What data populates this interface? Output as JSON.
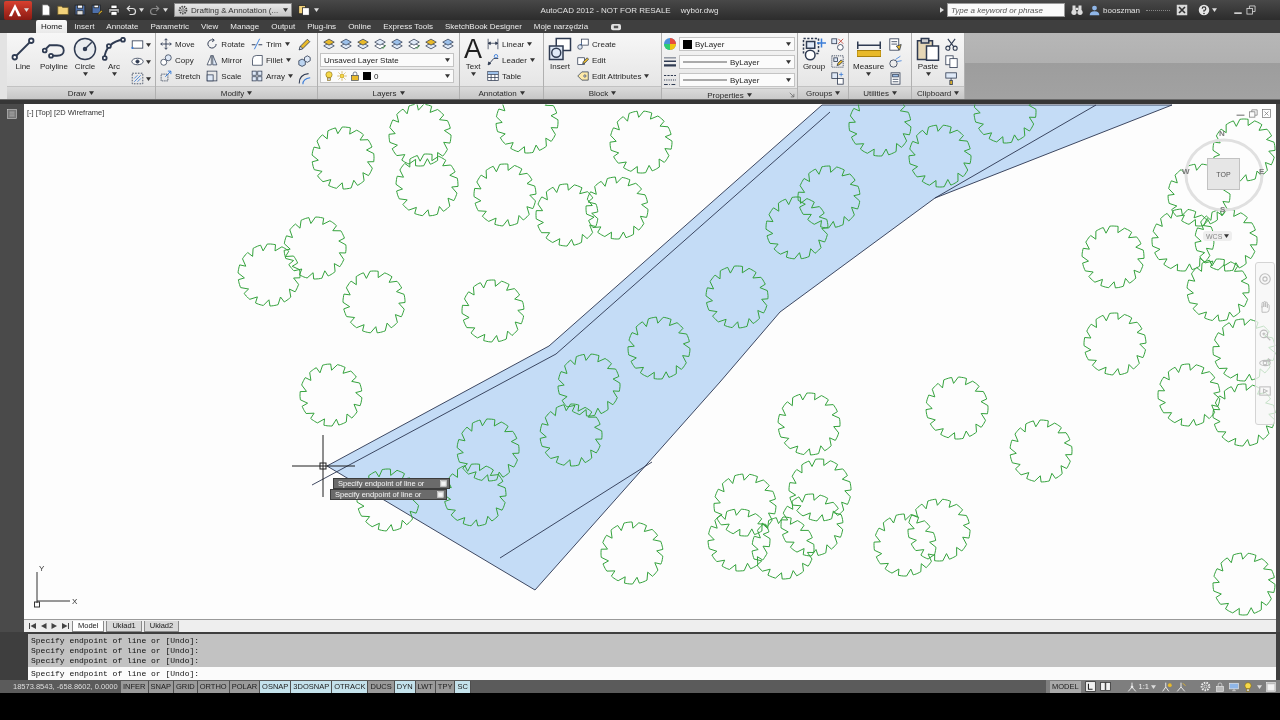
{
  "title_bar": {
    "workspace": "Drafting & Annotation (...",
    "title": "AutoCAD 2012 - NOT FOR RESALE",
    "file": "wybór.dwg",
    "search": {
      "placeholder": "Type a keyword or phrase"
    },
    "user": "booszman"
  },
  "ribbon_tabs": [
    {
      "label": "Home",
      "selected": true
    },
    {
      "label": "Insert",
      "selected": false
    },
    {
      "label": "Annotate",
      "selected": false
    },
    {
      "label": "Parametric",
      "selected": false
    },
    {
      "label": "View",
      "selected": false
    },
    {
      "label": "Manage",
      "selected": false
    },
    {
      "label": "Output",
      "selected": false
    },
    {
      "label": "Plug-ins",
      "selected": false
    },
    {
      "label": "Online",
      "selected": false
    },
    {
      "label": "Express Tools",
      "selected": false
    },
    {
      "label": "SketchBook Designer",
      "selected": false
    },
    {
      "label": "Moje narzędzia",
      "selected": false
    }
  ],
  "ribbon_panels": [
    {
      "title": "Draw",
      "kind": "tools",
      "large": [
        {
          "label": "Line",
          "dropdown": false
        },
        {
          "label": "Polyline",
          "dropdown": false
        },
        {
          "label": "Circle",
          "dropdown": true
        },
        {
          "label": "Arc",
          "dropdown": true
        }
      ]
    },
    {
      "title": "Modify",
      "kind": "tools",
      "small": [
        {
          "label": "Move",
          "dropdown": false
        },
        {
          "label": "Rotate",
          "dropdown": false
        },
        {
          "label": "Trim",
          "dropdown": true
        },
        {
          "label": "Copy",
          "dropdown": false
        },
        {
          "label": "Mirror",
          "dropdown": false
        },
        {
          "label": "Fillet",
          "dropdown": true
        },
        {
          "label": "Stretch",
          "dropdown": false
        },
        {
          "label": "Scale",
          "dropdown": false
        },
        {
          "label": "Array",
          "dropdown": true
        }
      ]
    },
    {
      "title": "Layers",
      "kind": "layers",
      "layer_state": "Unsaved Layer State",
      "current_layer": "0"
    },
    {
      "title": "Annotation",
      "kind": "tools",
      "large": [
        {
          "label": "Text",
          "glyph": "A",
          "dropdown": true
        }
      ],
      "small": [
        {
          "label": "Linear",
          "dropdown": true
        },
        {
          "label": "Leader",
          "dropdown": true
        },
        {
          "label": "Table",
          "dropdown": false
        }
      ]
    },
    {
      "title": "Block",
      "kind": "tools",
      "large": [
        {
          "label": "Insert",
          "dropdown": false
        }
      ],
      "small": [
        {
          "label": "Create",
          "dropdown": false
        },
        {
          "label": "Edit",
          "dropdown": false
        },
        {
          "label": "Edit Attributes",
          "dropdown": true
        }
      ]
    },
    {
      "title": "Properties",
      "kind": "properties",
      "object_color": "ByLayer",
      "lineweight": "ByLayer",
      "linetype": "ByLayer",
      "launcher": true
    },
    {
      "title": "Groups",
      "kind": "tools",
      "large": [
        {
          "label": "Group",
          "dropdown": false
        }
      ]
    },
    {
      "title": "Utilities",
      "kind": "tools",
      "large": [
        {
          "label": "Measure",
          "dropdown": true
        }
      ]
    },
    {
      "title": "Clipboard",
      "kind": "tools",
      "large": [
        {
          "label": "Paste",
          "dropdown": true
        }
      ]
    }
  ],
  "viewport": {
    "controls": [
      "[-]",
      "[Top]",
      "[2D Wireframe]"
    ],
    "view_cube": {
      "face": "TOP",
      "compass": [
        "N",
        "W",
        "E",
        "S"
      ],
      "coordinate_system": "WCS"
    },
    "ucs": {
      "x_label": "X",
      "y_label": "Y"
    },
    "dynamic_input": [
      "Specify endpoint of line or",
      "Specify endpoint of line or"
    ]
  },
  "layout_tabs": [
    {
      "label": "Model",
      "selected": true
    },
    {
      "label": "Układ1",
      "selected": false
    },
    {
      "label": "Układ2",
      "selected": false
    }
  ],
  "command_line": {
    "history": [
      "Specify endpoint of line or [Undo]:",
      "Specify endpoint of line or [Undo]:",
      "Specify endpoint of line or [Undo]:"
    ],
    "prompt": "Specify endpoint of line or [Undo]:"
  },
  "status_bar": {
    "coordinates": "18573.8543, -658.8602, 0.0000",
    "toggles": [
      {
        "label": "INFER",
        "on": false
      },
      {
        "label": "SNAP",
        "on": false
      },
      {
        "label": "GRID",
        "on": false
      },
      {
        "label": "ORTHO",
        "on": false
      },
      {
        "label": "POLAR",
        "on": false
      },
      {
        "label": "OSNAP",
        "on": true
      },
      {
        "label": "3DOSNAP",
        "on": true
      },
      {
        "label": "OTRACK",
        "on": true
      },
      {
        "label": "DUCS",
        "on": false
      },
      {
        "label": "DYN",
        "on": true
      },
      {
        "label": "LWT",
        "on": false
      },
      {
        "label": "TPY",
        "on": false
      },
      {
        "label": "SC",
        "on": true
      }
    ],
    "space": "MODEL",
    "annotation_scale": "1:1"
  }
}
